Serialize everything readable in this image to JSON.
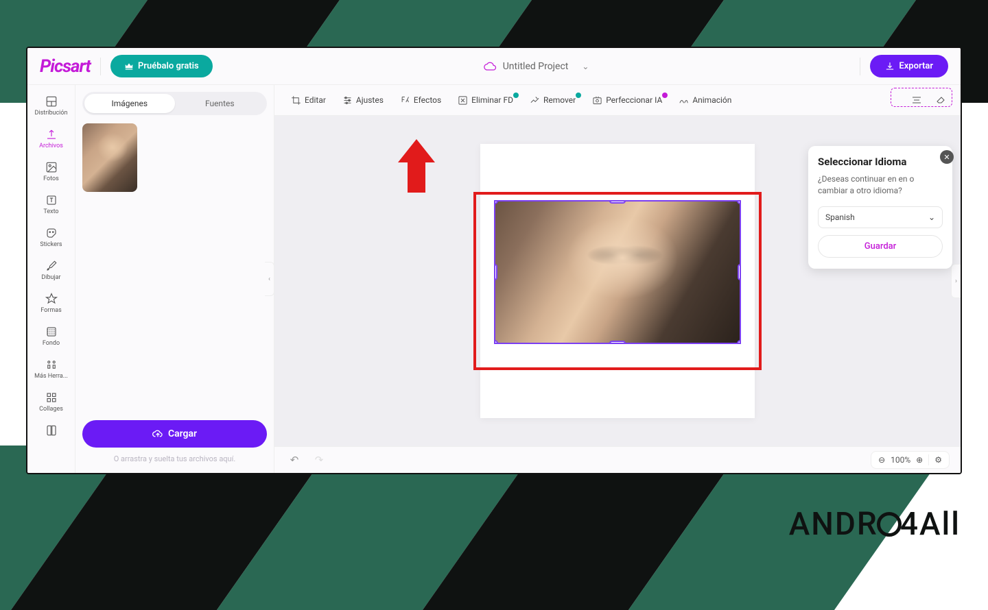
{
  "brand": {
    "logo": "Picsart",
    "try_free": "Pruébalo gratis"
  },
  "header": {
    "project_name": "Untitled Project",
    "export": "Exportar"
  },
  "leftnav": {
    "items": [
      {
        "id": "distribucion",
        "label": "Distribución"
      },
      {
        "id": "archivos",
        "label": "Archivos"
      },
      {
        "id": "fotos",
        "label": "Fotos"
      },
      {
        "id": "texto",
        "label": "Texto"
      },
      {
        "id": "stickers",
        "label": "Stickers"
      },
      {
        "id": "dibujar",
        "label": "Dibujar"
      },
      {
        "id": "formas",
        "label": "Formas"
      },
      {
        "id": "fondo",
        "label": "Fondo"
      },
      {
        "id": "mas",
        "label": "Más Herra..."
      },
      {
        "id": "collages",
        "label": "Collages"
      }
    ],
    "active": "archivos"
  },
  "sidepanel": {
    "tabs": {
      "images": "Imágenes",
      "fonts": "Fuentes"
    },
    "upload": "Cargar",
    "drop_hint": "O arrastra y suelta tus archivos aquí."
  },
  "toolbar": {
    "editar": "Editar",
    "ajustes": "Ajustes",
    "efectos": "Efectos",
    "eliminar_fd": "Eliminar FD",
    "remover": "Remover",
    "perfeccionar_ia": "Perfeccionar IA",
    "animacion": "Animación"
  },
  "bottombar": {
    "zoom": "100%"
  },
  "lang_popup": {
    "title": "Seleccionar Idioma",
    "question": "¿Deseas continuar en en o cambiar a otro idioma?",
    "selected": "Spanish",
    "save": "Guardar"
  },
  "watermark": "ANDRO4ALL"
}
